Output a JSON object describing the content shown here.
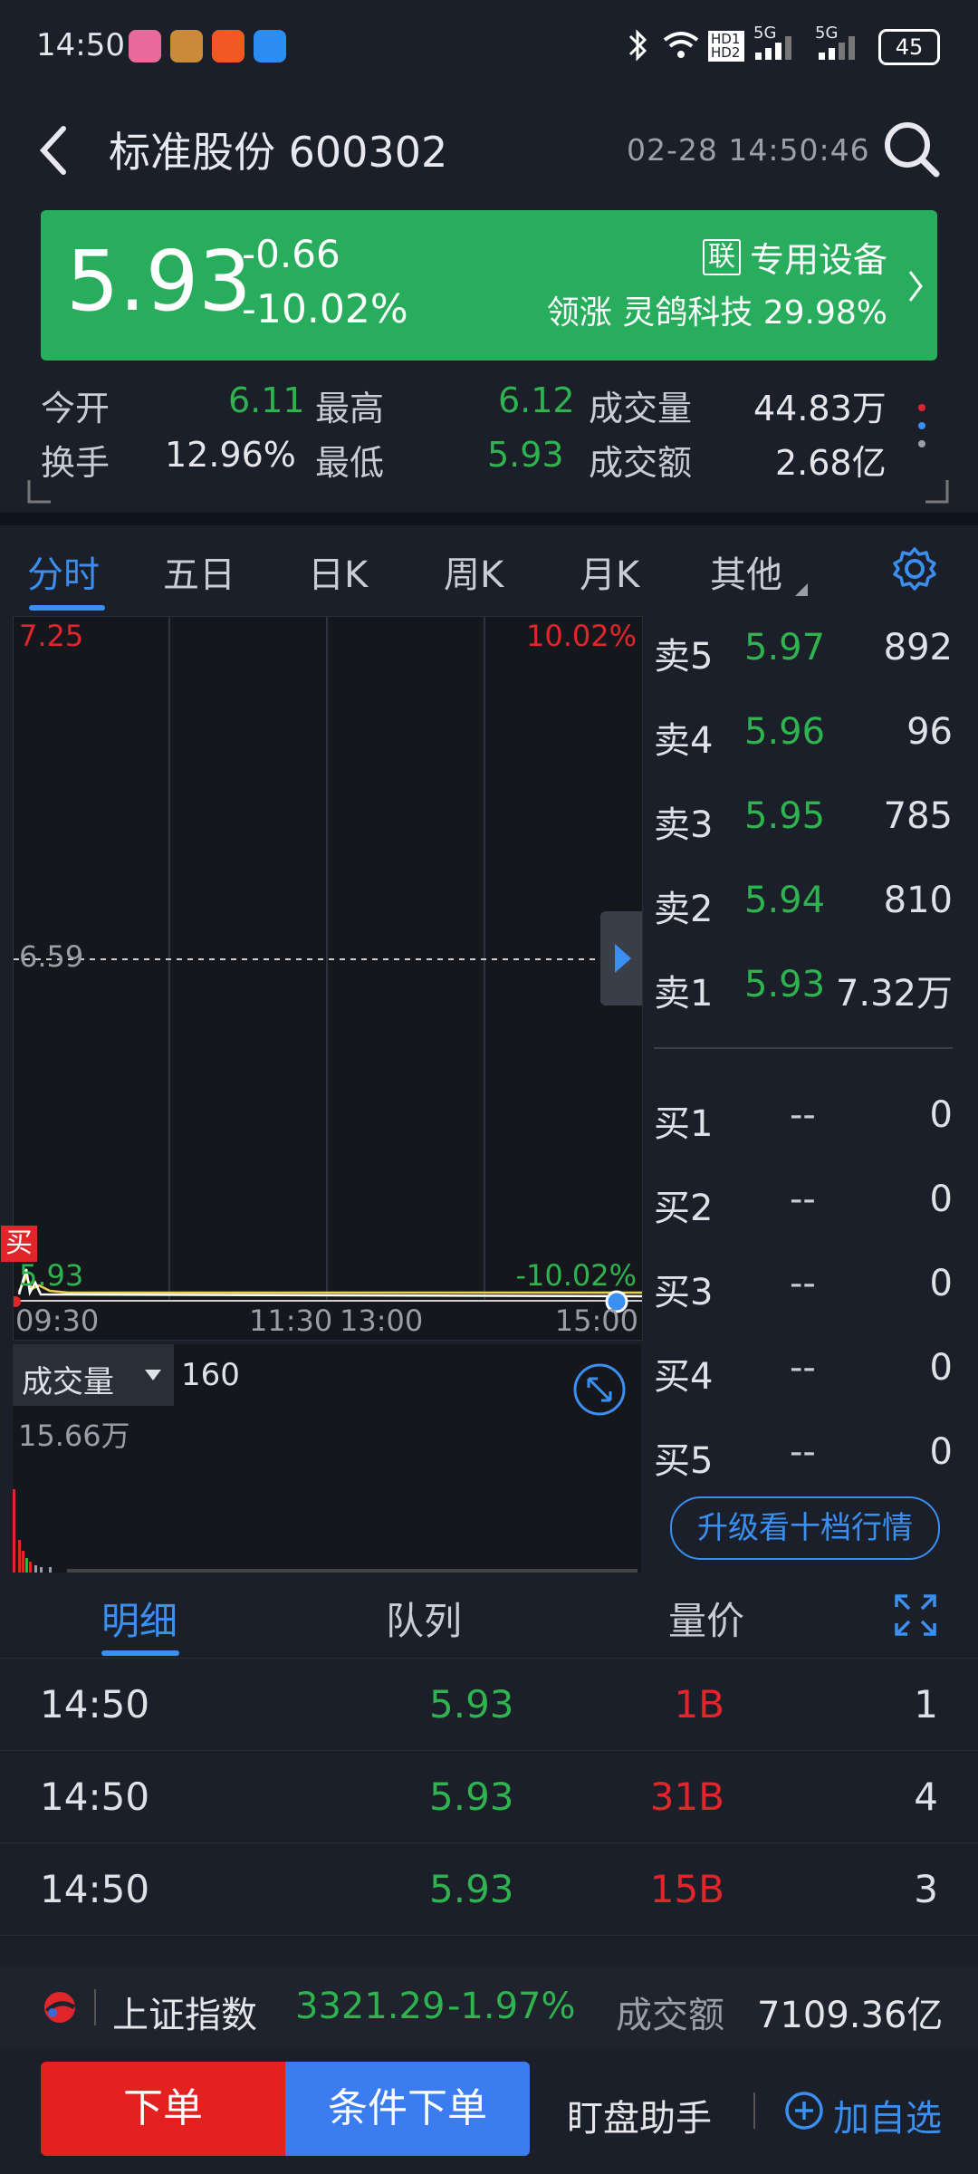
{
  "status_bar": {
    "time": "14:50",
    "battery": "45",
    "net1": "5G",
    "net2": "5G",
    "hd": "HD1 HD2"
  },
  "header": {
    "title": "标准股份 600302",
    "datetime": "02-28 14:50:46"
  },
  "price": {
    "last": "5.93",
    "change": "-0.66",
    "change_pct": "-10.02%",
    "sector_badge": "联",
    "sector": "专用设备",
    "leader_label": "领涨",
    "leader_name": "灵鸽科技",
    "leader_pct": "29.98%"
  },
  "stats": {
    "open_label": "今开",
    "open": "6.11",
    "high_label": "最高",
    "high": "6.12",
    "volume_label": "成交量",
    "volume": "44.83万",
    "turnover_label": "换手",
    "turnover": "12.96%",
    "low_label": "最低",
    "low": "5.93",
    "amount_label": "成交额",
    "amount": "2.68亿"
  },
  "tabs": [
    "分时",
    "五日",
    "日K",
    "周K",
    "月K",
    "其他"
  ],
  "chart": {
    "top_price": "7.25",
    "top_pct": "10.02%",
    "mid_price": "6.59",
    "bottom_price": "5.93",
    "bottom_pct": "-10.02%",
    "buy_marker": "买",
    "time_labels": [
      "09:30",
      "11:30",
      "13:00",
      "15:00"
    ]
  },
  "volume_panel": {
    "label": "成交量",
    "value": "160",
    "max": "15.66万"
  },
  "order_book": {
    "asks": [
      {
        "label": "卖5",
        "price": "5.97",
        "qty": "892"
      },
      {
        "label": "卖4",
        "price": "5.96",
        "qty": "96"
      },
      {
        "label": "卖3",
        "price": "5.95",
        "qty": "785"
      },
      {
        "label": "卖2",
        "price": "5.94",
        "qty": "810"
      },
      {
        "label": "卖1",
        "price": "5.93",
        "qty": "7.32万"
      }
    ],
    "bids": [
      {
        "label": "买1",
        "price": "--",
        "qty": "0"
      },
      {
        "label": "买2",
        "price": "--",
        "qty": "0"
      },
      {
        "label": "买3",
        "price": "--",
        "qty": "0"
      },
      {
        "label": "买4",
        "price": "--",
        "qty": "0"
      },
      {
        "label": "买5",
        "price": "--",
        "qty": "0"
      }
    ],
    "upgrade_label": "升级看十档行情"
  },
  "detail_tabs": [
    "明细",
    "队列",
    "量价"
  ],
  "trades": [
    {
      "time": "14:50",
      "price": "5.93",
      "volume": "1B",
      "count": "1"
    },
    {
      "time": "14:50",
      "price": "5.93",
      "volume": "31B",
      "count": "4"
    },
    {
      "time": "14:50",
      "price": "5.93",
      "volume": "15B",
      "count": "3"
    }
  ],
  "index_bar": {
    "name": "上证指数",
    "value": "3321.29",
    "change_pct": "-1.97%",
    "amount_label": "成交额",
    "amount": "7109.36亿"
  },
  "actions": {
    "order": "下单",
    "conditional": "条件下单",
    "assistant": "盯盘助手",
    "watchlist": "加自选"
  }
}
